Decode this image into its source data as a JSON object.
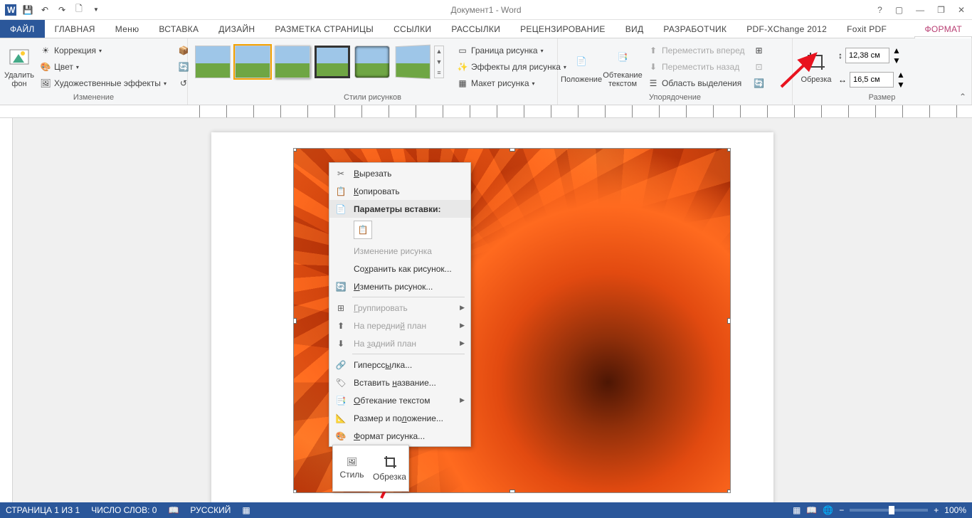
{
  "title": "Документ1 - Word",
  "qat": {
    "save": "💾",
    "undo": "↶",
    "redo": "↷",
    "new": "🗋"
  },
  "tabs": [
    "ФАЙЛ",
    "ГЛАВНАЯ",
    "Меню",
    "ВСТАВКА",
    "ДИЗАЙН",
    "РАЗМЕТКА СТРАНИЦЫ",
    "ССЫЛКИ",
    "РАССЫЛКИ",
    "РЕЦЕНЗИРОВАНИЕ",
    "ВИД",
    "РАЗРАБОТЧИК",
    "PDF-XChange 2012",
    "Foxit PDF",
    "ФОРМАТ"
  ],
  "groups": {
    "g1": {
      "label": "Изменение",
      "btn": "Удалить фон",
      "c1": "Коррекция",
      "c2": "Цвет",
      "c3": "Художественные эффекты"
    },
    "g2": {
      "label": "Стили рисунков",
      "o1": "Граница рисунка",
      "o2": "Эффекты для рисунка",
      "o3": "Макет рисунка"
    },
    "g3": {
      "label": "Упорядочение",
      "p": "Положение",
      "w": "Обтекание текстом",
      "f": "Переместить вперед",
      "b": "Переместить назад",
      "s": "Область выделения"
    },
    "g4": {
      "label": "Размер",
      "c": "Обрезка",
      "h": "12,38 см",
      "w": "16,5 см"
    }
  },
  "ctx": {
    "cut": "Вырезать",
    "copy": "Копировать",
    "pasteHeader": "Параметры вставки:",
    "editPic": "Изменение рисунка",
    "saveAs": "Сохранить как рисунок...",
    "change": "Изменить рисунок...",
    "group": "Группировать",
    "front": "На передний план",
    "back": "На задний план",
    "link": "Гиперссылка...",
    "caption": "Вставить название...",
    "wrap": "Обтекание текстом",
    "sizePos": "Размер и положение...",
    "fmt": "Формат рисунка..."
  },
  "mini": {
    "style": "Стиль",
    "crop": "Обрезка"
  },
  "status": {
    "page": "СТРАНИЦА 1 ИЗ 1",
    "words": "ЧИСЛО СЛОВ: 0",
    "lang": "РУССКИЙ",
    "zoom": "100%"
  }
}
